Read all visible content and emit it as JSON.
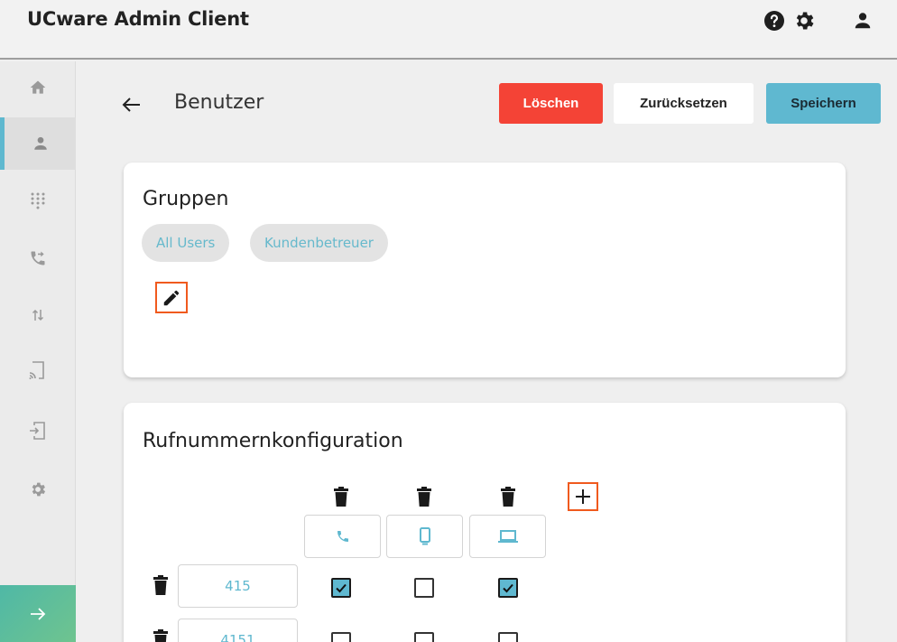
{
  "header": {
    "title": "UCware Admin Client"
  },
  "top_icons": [
    "help-icon",
    "settings-icon",
    "user-icon"
  ],
  "sidebar": {
    "items": [
      "home-icon",
      "user-icon",
      "dialpad-icon",
      "call-forward-icon",
      "transfer-icon",
      "cast-icon",
      "device-login-icon",
      "settings-icon"
    ],
    "active_index": 1
  },
  "page": {
    "title": "Benutzer"
  },
  "actions": {
    "delete": "Löschen",
    "reset": "Zurücksetzen",
    "save": "Speichern"
  },
  "colors": {
    "accent": "#5fb8d0",
    "danger": "#f44336",
    "highlight": "#f05a1e"
  },
  "groups": {
    "title": "Gruppen",
    "chips": [
      "All Users",
      "Kundenbetreuer"
    ]
  },
  "numbers": {
    "title": "Rufnummernkonfiguration",
    "devices": [
      "phone-icon",
      "mobile-icon",
      "laptop-icon"
    ],
    "rows": [
      {
        "number": "415",
        "checks": [
          true,
          false,
          true
        ]
      },
      {
        "number": "4151",
        "checks": [
          false,
          false,
          false
        ]
      }
    ]
  }
}
